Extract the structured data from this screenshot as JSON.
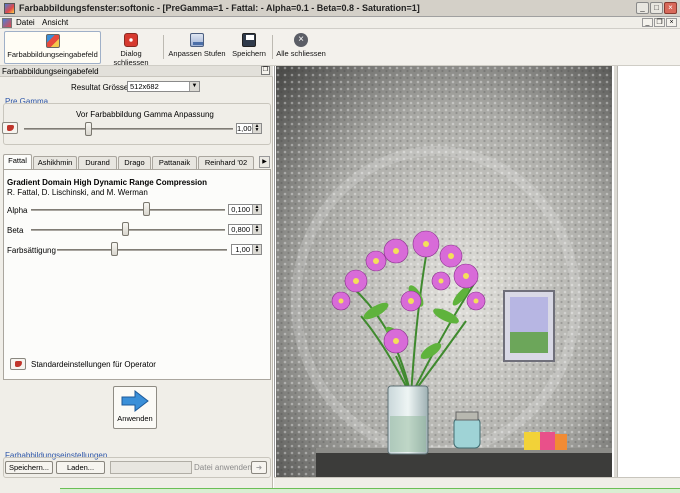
{
  "window": {
    "title": "Farbabbildungsfenster:softonic - [PreGamma=1 - Fattal: - Alpha=0.1 - Beta=0.8 - Saturation=1]",
    "minimize": "_",
    "maximize": "□",
    "close": "×"
  },
  "menu": [
    "Datei",
    "Ansicht"
  ],
  "toolbar": {
    "items": [
      {
        "label": "Farbabbildungseingabefeld",
        "icon": "palette-icon"
      },
      {
        "label": "Dialog schliessen",
        "icon": "power-icon"
      },
      {
        "label": "Anpassen Stufen",
        "icon": "levels-icon"
      },
      {
        "label": "Speichern",
        "icon": "floppy-disk-icon"
      },
      {
        "label": "Alle schliessen",
        "icon": "close-circle-icon"
      }
    ]
  },
  "panel": {
    "title": "Farbabbildungseingabefeld",
    "result_size_label": "Resultat Grösse:",
    "result_size_value": "512x682",
    "pregamma": {
      "section_label": "Pre Gamma",
      "caption": "Vor Farbabbildung Gamma Anpassung",
      "value": "1,000",
      "level": 0.31
    },
    "tabs": [
      "Fattal",
      "Ashikhmin",
      "Durand",
      "Drago",
      "Pattanaik",
      "Reinhard '02"
    ],
    "active_tab": "Fattal",
    "operator": {
      "heading": "Gradient Domain High Dynamic Range Compression",
      "authors": "R. Fattal, D. Lischinski, and M. Werman",
      "params": [
        {
          "label": "Alpha",
          "value": "0,100",
          "level": 0.6
        },
        {
          "label": "Beta",
          "value": "0,800",
          "level": 0.49
        },
        {
          "label": "Farbsättigung",
          "value": "1,00",
          "level": 0.34
        }
      ],
      "defaults_label": "Standardeinstellungen für Operator"
    },
    "apply_label": "Anwenden",
    "settings": {
      "section_label": "Farbabbildungseinstellungen",
      "save_label": "Speichern...",
      "load_label": "Laden...",
      "apply_file_label": "Datei anwenden"
    }
  },
  "colors": {
    "accent": "#2c55a8",
    "close_red": "#d8695a",
    "apply_arrow": "#3a8fd8"
  }
}
